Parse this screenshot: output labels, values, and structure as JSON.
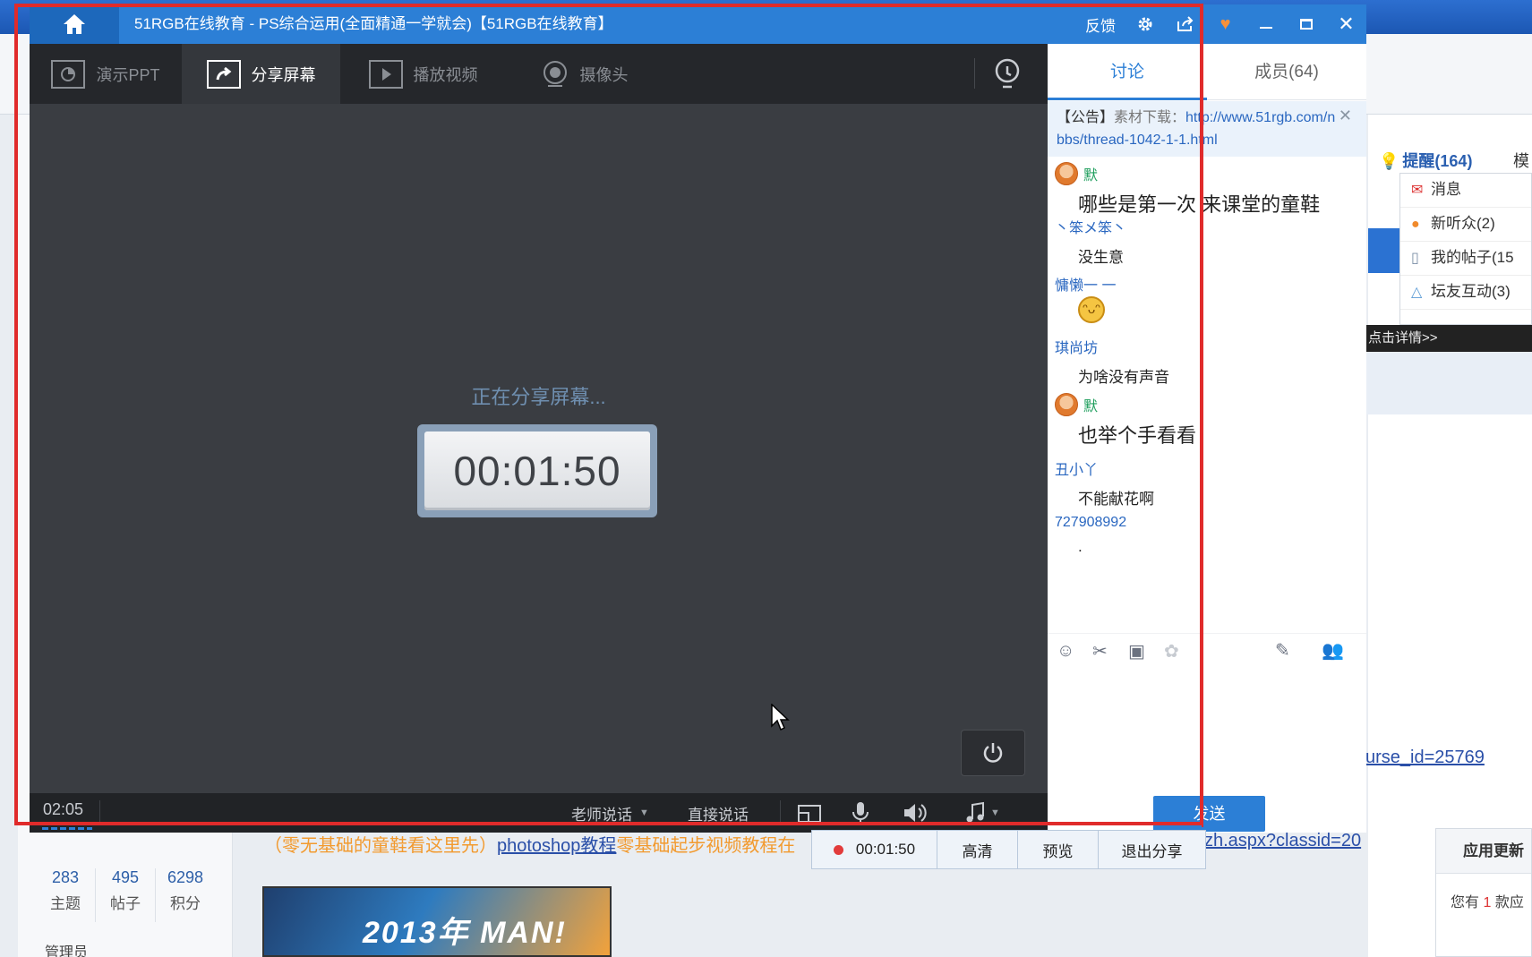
{
  "window": {
    "title": "51RGB在线教育 - PS综合运用(全面精通一学就会)【51RGB在线教育】",
    "feedback_label": "反馈"
  },
  "toolbar": {
    "items": [
      {
        "label": "演示PPT",
        "icon": "ppt-icon"
      },
      {
        "label": "分享屏幕",
        "icon": "share-screen-icon"
      },
      {
        "label": "播放视频",
        "icon": "play-video-icon"
      },
      {
        "label": "摄像头",
        "icon": "camera-icon"
      }
    ]
  },
  "stage": {
    "status": "正在分享屏幕...",
    "timer": "00:01:50"
  },
  "bottom_bar": {
    "elapsed": "02:05",
    "teacher_speak": "老师说话",
    "direct_speak": "直接说话"
  },
  "panel": {
    "tabs": [
      "讨论",
      "成员(64)"
    ],
    "notice_prefix": "【公告】",
    "notice_label": "素材下载：",
    "notice_url": "http://www.51rgb.com/nbbs/thread-1042-1-1.html",
    "messages": [
      {
        "name": "默",
        "text": "哪些是第一次 来课堂的童鞋"
      },
      {
        "name": "丶笨メ笨丶",
        "text": "没生意"
      },
      {
        "name": "慵懒一 一",
        "text": ""
      },
      {
        "name": "琪尚坊",
        "text": "为啥没有声音"
      },
      {
        "name": "默",
        "text": "也举个手看看"
      },
      {
        "name": "丑小丫",
        "text": "不能献花啊"
      },
      {
        "name": "727908992",
        "text": "."
      }
    ],
    "send_label": "发送"
  },
  "share_bar": {
    "timer": "00:01:50",
    "hd": "高清",
    "preview": "预览",
    "exit": "退出分享"
  },
  "background_page": {
    "remind": "提醒(164)",
    "remind_more": "模",
    "notif_items": [
      {
        "label": "消息",
        "count": ""
      },
      {
        "label": "新听众(2)",
        "count": ""
      },
      {
        "label": "我的帖子(15",
        "count": ""
      },
      {
        "label": "坛友互动(3)",
        "count": ""
      }
    ],
    "detail_link": "点击详情>>",
    "orange_text": "（零无基础的童鞋看这里先）",
    "link_text": "photoshop教程",
    "orange_tail": "零基础起步视频教程在",
    "url_tail": "zh.aspx?classid=20",
    "course_url": "urse_id=25769",
    "stats": [
      {
        "n": "283",
        "l": "主题"
      },
      {
        "n": "495",
        "l": "帖子"
      },
      {
        "n": "6298",
        "l": "积分"
      }
    ],
    "admin": "管理员",
    "update_title": "应用更新",
    "update_body_pre": "您有",
    "update_count": "1",
    "update_body_post": "款应",
    "banner_text": "2013年 MAN!"
  }
}
